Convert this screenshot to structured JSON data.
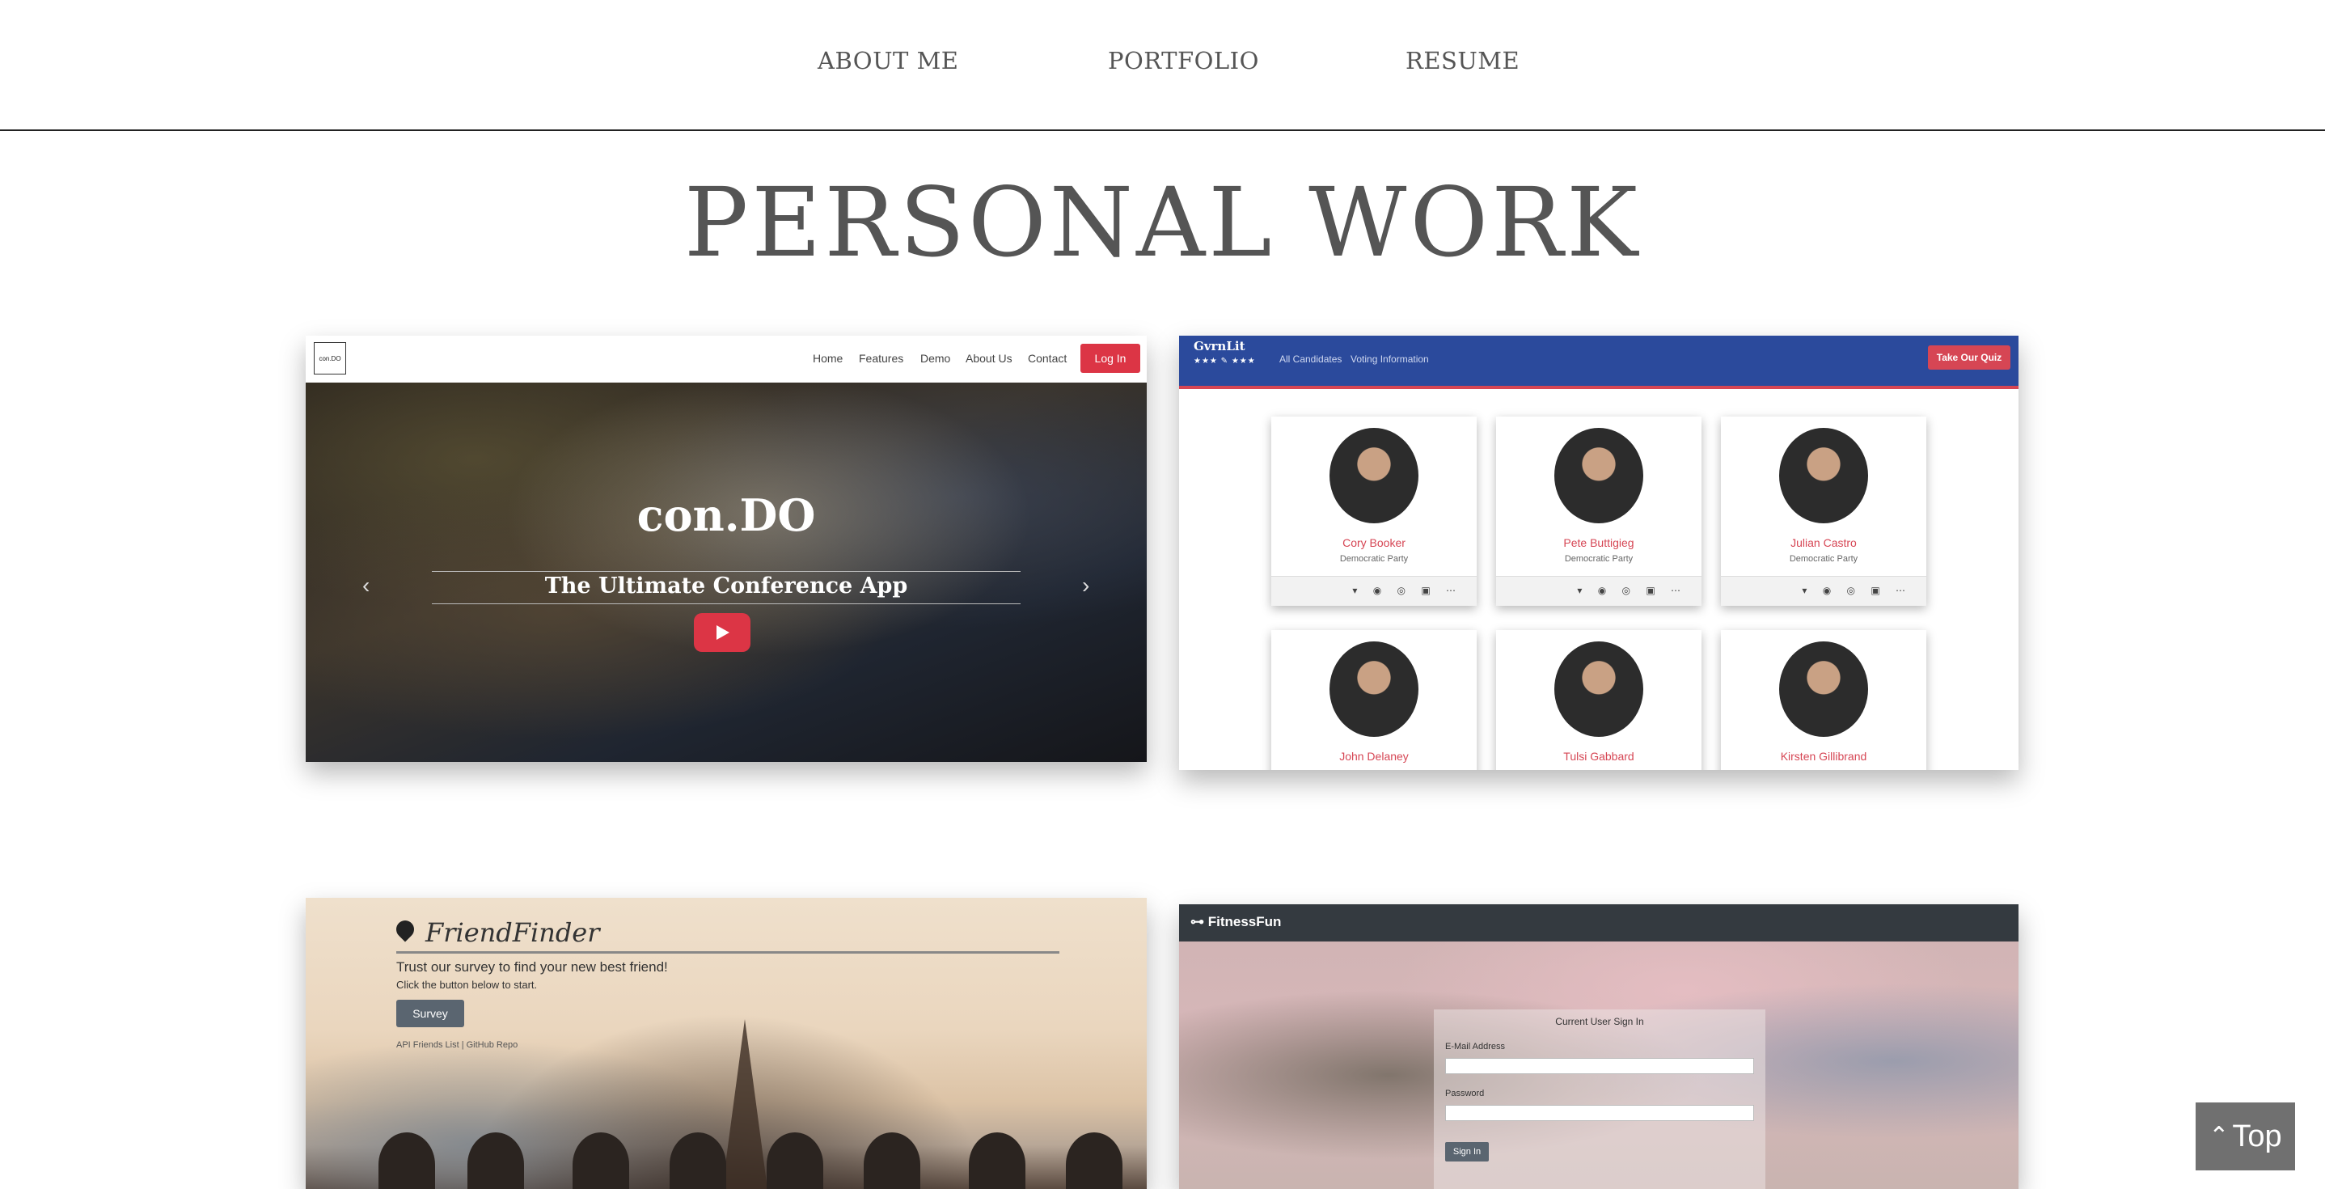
{
  "nav": {
    "about": "ABOUT ME",
    "portfolio": "PORTFOLIO",
    "resume": "RESUME"
  },
  "page_title": "PERSONAL WORK",
  "projects": {
    "condo": {
      "logo": "con.DO",
      "links": [
        "Home",
        "Features",
        "Demo",
        "About Us",
        "Contact"
      ],
      "login": "Log In",
      "title": "con.DO",
      "subtitle": "The Ultimate Conference App",
      "prev_icon": "‹",
      "next_icon": "›"
    },
    "gvrnlit": {
      "brand": "GvrnLit",
      "stars": "★★★ ✎ ★★★",
      "links": [
        "All Candidates",
        "Voting Information"
      ],
      "quiz": "Take Our Quiz",
      "social_icons": "▾ ◉ ◎ ▣ ⋯",
      "candidates": [
        {
          "name": "Cory Booker",
          "party": "Democratic Party"
        },
        {
          "name": "Pete Buttigieg",
          "party": "Democratic Party"
        },
        {
          "name": "Julian Castro",
          "party": "Democratic Party"
        },
        {
          "name": "John Delaney",
          "party": ""
        },
        {
          "name": "Tulsi Gabbard",
          "party": ""
        },
        {
          "name": "Kirsten Gillibrand",
          "party": ""
        }
      ]
    },
    "friendfinder": {
      "brand": "FriendFinder",
      "tagline": "Trust our survey to find your new best friend!",
      "instruction": "Click the button below to start.",
      "button": "Survey",
      "links": "API Friends List | GitHub Repo"
    },
    "fitnessfun": {
      "brand": "FitnessFun",
      "form_title": "Current User Sign In",
      "email_label": "E-Mail Address",
      "password_label": "Password",
      "signin": "Sign In"
    }
  },
  "top_button": {
    "icon": "chevron-up-double-icon",
    "label": "Top"
  }
}
